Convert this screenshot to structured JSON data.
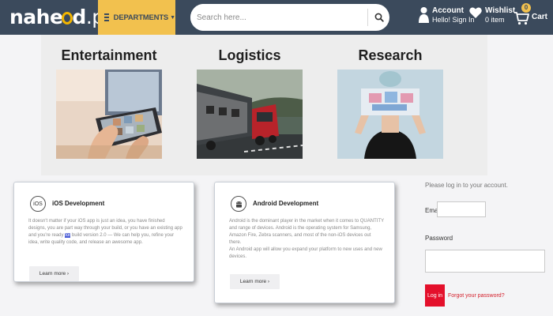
{
  "brand": {
    "name": "nahe",
    "name_rest": "d",
    "tld": ".pk",
    "accent": "#f2b500"
  },
  "header": {
    "background": "#3b4a5c",
    "departments_label": "DEPARTMENTS",
    "search_placeholder": "Search here...",
    "account": {
      "title": "Account",
      "subtitle": "Hello! Sign In"
    },
    "wishlist": {
      "title": "Wishlist",
      "subtitle": "0 item"
    },
    "cart": {
      "label": "Cart",
      "count": "0"
    }
  },
  "departments": [
    {
      "title": "Entertainment",
      "icon": "tablet-photo"
    },
    {
      "title": "Logistics",
      "icon": "truck-photo"
    },
    {
      "title": "Research",
      "icon": "woman-holding-papers-photo"
    }
  ],
  "cards": [
    {
      "icon_text": "iOS",
      "title": "iOS Development",
      "body_pre": "It doesn't matter if your iOS app is just an idea, you have finished designs, you are part way through your build, or you have an existing app and you're ready ",
      "body_hl": "for",
      "body_post": " build version 2.0 — We can help you, refine your idea, write quality code, and release an awesome app.",
      "button": "Learn more ›"
    },
    {
      "icon_text": "android-icon",
      "title": "Android Development",
      "body_p1": "Android is the dominant player in the market when it comes to QUANTITY and range of devices. Android is the operating system for Samsung, Amazon Fire, Zebra scanners, and most of the non-iOS devices out there.",
      "body_p2": "An Android app will allow you expand your platform to new uses and new devices.",
      "button": "Learn more ›"
    }
  ],
  "login": {
    "prompt": "Please log in to your account.",
    "email_label": "Email",
    "email_value": "",
    "password_label": "Password",
    "password_value": "",
    "button": "Log in",
    "forgot": "Forgot your password?",
    "button_color": "#e4102b"
  }
}
